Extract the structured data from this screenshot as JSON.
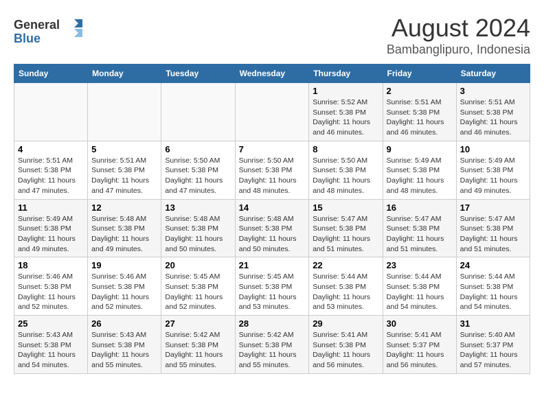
{
  "header": {
    "logo_line1": "General",
    "logo_line2": "Blue",
    "title": "August 2024",
    "subtitle": "Bambanglipuro, Indonesia"
  },
  "days_of_week": [
    "Sunday",
    "Monday",
    "Tuesday",
    "Wednesday",
    "Thursday",
    "Friday",
    "Saturday"
  ],
  "weeks": [
    [
      {
        "day": "",
        "info": ""
      },
      {
        "day": "",
        "info": ""
      },
      {
        "day": "",
        "info": ""
      },
      {
        "day": "",
        "info": ""
      },
      {
        "day": "1",
        "info": "Sunrise: 5:52 AM\nSunset: 5:38 PM\nDaylight: 11 hours\nand 46 minutes."
      },
      {
        "day": "2",
        "info": "Sunrise: 5:51 AM\nSunset: 5:38 PM\nDaylight: 11 hours\nand 46 minutes."
      },
      {
        "day": "3",
        "info": "Sunrise: 5:51 AM\nSunset: 5:38 PM\nDaylight: 11 hours\nand 46 minutes."
      }
    ],
    [
      {
        "day": "4",
        "info": "Sunrise: 5:51 AM\nSunset: 5:38 PM\nDaylight: 11 hours\nand 47 minutes."
      },
      {
        "day": "5",
        "info": "Sunrise: 5:51 AM\nSunset: 5:38 PM\nDaylight: 11 hours\nand 47 minutes."
      },
      {
        "day": "6",
        "info": "Sunrise: 5:50 AM\nSunset: 5:38 PM\nDaylight: 11 hours\nand 47 minutes."
      },
      {
        "day": "7",
        "info": "Sunrise: 5:50 AM\nSunset: 5:38 PM\nDaylight: 11 hours\nand 48 minutes."
      },
      {
        "day": "8",
        "info": "Sunrise: 5:50 AM\nSunset: 5:38 PM\nDaylight: 11 hours\nand 48 minutes."
      },
      {
        "day": "9",
        "info": "Sunrise: 5:49 AM\nSunset: 5:38 PM\nDaylight: 11 hours\nand 48 minutes."
      },
      {
        "day": "10",
        "info": "Sunrise: 5:49 AM\nSunset: 5:38 PM\nDaylight: 11 hours\nand 49 minutes."
      }
    ],
    [
      {
        "day": "11",
        "info": "Sunrise: 5:49 AM\nSunset: 5:38 PM\nDaylight: 11 hours\nand 49 minutes."
      },
      {
        "day": "12",
        "info": "Sunrise: 5:48 AM\nSunset: 5:38 PM\nDaylight: 11 hours\nand 49 minutes."
      },
      {
        "day": "13",
        "info": "Sunrise: 5:48 AM\nSunset: 5:38 PM\nDaylight: 11 hours\nand 50 minutes."
      },
      {
        "day": "14",
        "info": "Sunrise: 5:48 AM\nSunset: 5:38 PM\nDaylight: 11 hours\nand 50 minutes."
      },
      {
        "day": "15",
        "info": "Sunrise: 5:47 AM\nSunset: 5:38 PM\nDaylight: 11 hours\nand 51 minutes."
      },
      {
        "day": "16",
        "info": "Sunrise: 5:47 AM\nSunset: 5:38 PM\nDaylight: 11 hours\nand 51 minutes."
      },
      {
        "day": "17",
        "info": "Sunrise: 5:47 AM\nSunset: 5:38 PM\nDaylight: 11 hours\nand 51 minutes."
      }
    ],
    [
      {
        "day": "18",
        "info": "Sunrise: 5:46 AM\nSunset: 5:38 PM\nDaylight: 11 hours\nand 52 minutes."
      },
      {
        "day": "19",
        "info": "Sunrise: 5:46 AM\nSunset: 5:38 PM\nDaylight: 11 hours\nand 52 minutes."
      },
      {
        "day": "20",
        "info": "Sunrise: 5:45 AM\nSunset: 5:38 PM\nDaylight: 11 hours\nand 52 minutes."
      },
      {
        "day": "21",
        "info": "Sunrise: 5:45 AM\nSunset: 5:38 PM\nDaylight: 11 hours\nand 53 minutes."
      },
      {
        "day": "22",
        "info": "Sunrise: 5:44 AM\nSunset: 5:38 PM\nDaylight: 11 hours\nand 53 minutes."
      },
      {
        "day": "23",
        "info": "Sunrise: 5:44 AM\nSunset: 5:38 PM\nDaylight: 11 hours\nand 54 minutes."
      },
      {
        "day": "24",
        "info": "Sunrise: 5:44 AM\nSunset: 5:38 PM\nDaylight: 11 hours\nand 54 minutes."
      }
    ],
    [
      {
        "day": "25",
        "info": "Sunrise: 5:43 AM\nSunset: 5:38 PM\nDaylight: 11 hours\nand 54 minutes."
      },
      {
        "day": "26",
        "info": "Sunrise: 5:43 AM\nSunset: 5:38 PM\nDaylight: 11 hours\nand 55 minutes."
      },
      {
        "day": "27",
        "info": "Sunrise: 5:42 AM\nSunset: 5:38 PM\nDaylight: 11 hours\nand 55 minutes."
      },
      {
        "day": "28",
        "info": "Sunrise: 5:42 AM\nSunset: 5:38 PM\nDaylight: 11 hours\nand 55 minutes."
      },
      {
        "day": "29",
        "info": "Sunrise: 5:41 AM\nSunset: 5:38 PM\nDaylight: 11 hours\nand 56 minutes."
      },
      {
        "day": "30",
        "info": "Sunrise: 5:41 AM\nSunset: 5:37 PM\nDaylight: 11 hours\nand 56 minutes."
      },
      {
        "day": "31",
        "info": "Sunrise: 5:40 AM\nSunset: 5:37 PM\nDaylight: 11 hours\nand 57 minutes."
      }
    ]
  ]
}
